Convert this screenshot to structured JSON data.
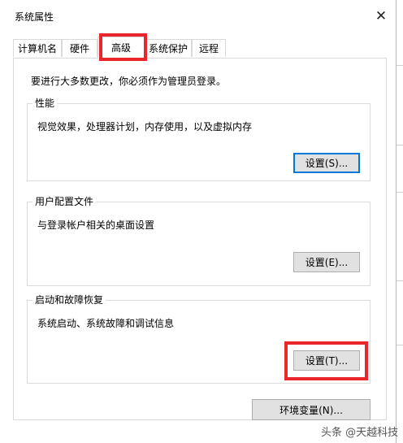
{
  "window": {
    "title": "系统属性",
    "close_glyph": "✕"
  },
  "tabs": [
    {
      "label": "计算机名"
    },
    {
      "label": "硬件"
    },
    {
      "label": "高级"
    },
    {
      "label": "系统保护"
    },
    {
      "label": "远程"
    }
  ],
  "active_tab": "高级",
  "notice": "要进行大多数更改，你必须作为管理员登录。",
  "groups": {
    "performance": {
      "label": "性能",
      "description": "视觉效果，处理器计划，内存使用，以及虚拟内存",
      "button_label": "设置(S)..."
    },
    "user_profiles": {
      "label": "用户配置文件",
      "description": "与登录帐户相关的桌面设置",
      "button_label": "设置(E)..."
    },
    "startup_recovery": {
      "label": "启动和故障恢复",
      "description": "系统启动、系统故障和调试信息",
      "button_label": "设置(T)..."
    }
  },
  "env_button_label": "环境变量(N)...",
  "watermark": "头条 @天越科技",
  "colors": {
    "highlight": "#e8262b",
    "focus_border": "#0078d7",
    "button_bg": "#e1e1e1"
  }
}
